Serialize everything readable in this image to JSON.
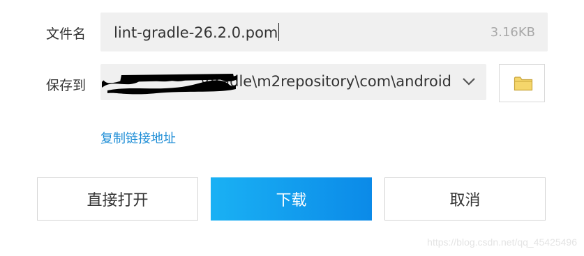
{
  "file": {
    "label": "文件名",
    "name": "lint-gradle-26.2.0.pom",
    "size": "3.16KB"
  },
  "save": {
    "label": "保存到",
    "path_visible": "\\gradle\\m2repository\\com\\android"
  },
  "copy_link_label": "复制链接地址",
  "buttons": {
    "open": "直接打开",
    "download": "下载",
    "cancel": "取消"
  },
  "watermark": "https://blog.csdn.net/qq_45425496",
  "icons": {
    "path_dropdown": "chevron-down-icon",
    "browse_folder": "folder-icon"
  },
  "colors": {
    "download_gradient_start": "#1ab1f4",
    "download_gradient_end": "#0b8ae8",
    "link": "#1d8dd6",
    "folder": "#f5d66b"
  }
}
